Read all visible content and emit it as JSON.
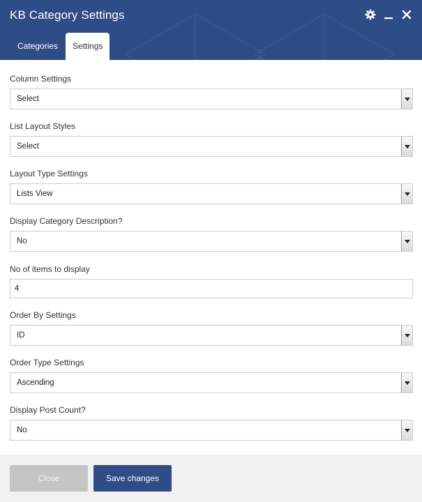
{
  "window": {
    "title": "KB Category Settings"
  },
  "header_icons": [
    "gear-icon",
    "minimize-icon",
    "close-icon"
  ],
  "tabs": [
    {
      "label": "Categories",
      "active": false
    },
    {
      "label": "Settings",
      "active": true
    }
  ],
  "fields": {
    "column_settings": {
      "label": "Column Settings",
      "value": "Select"
    },
    "list_layout_styles": {
      "label": "List Layout Styles",
      "value": "Select"
    },
    "layout_type_settings": {
      "label": "Layout Type Settings",
      "value": "Lists View"
    },
    "display_category_description": {
      "label": "Display Category Description?",
      "value": "No"
    },
    "no_of_items": {
      "label": "No of items to display",
      "value": "4"
    },
    "order_by_settings": {
      "label": "Order By Settings",
      "value": "ID"
    },
    "order_type_settings": {
      "label": "Order Type Settings",
      "value": "Ascending"
    },
    "display_post_count": {
      "label": "Display Post Count?",
      "value": "No"
    }
  },
  "footer": {
    "close_label": "Close",
    "save_label": "Save changes"
  },
  "colors": {
    "header_bg": "#2e4d86",
    "primary_button": "#2e4d86",
    "disabled_button": "#c5c5c5",
    "footer_bg": "#f1f1f1"
  }
}
